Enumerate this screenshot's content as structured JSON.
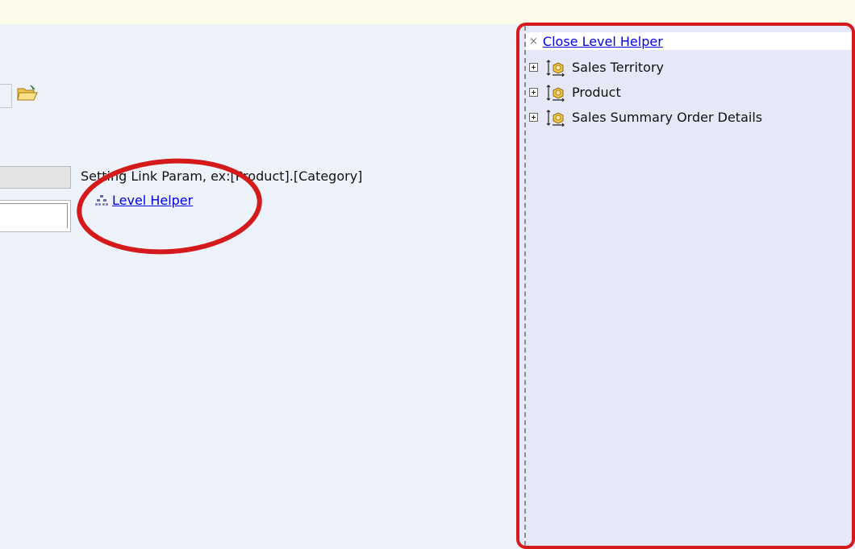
{
  "hint": {
    "text": "Setting Link Param, ex:[Product].[Category]"
  },
  "level_helper_link": {
    "label": "Level Helper"
  },
  "panel": {
    "close_label": "Close Level Helper",
    "close_glyph": "×",
    "items": [
      {
        "label": "Sales Territory",
        "icon": "cube-icon"
      },
      {
        "label": "Product",
        "icon": "cube-icon"
      },
      {
        "label": "Sales Summary Order Details",
        "icon": "cube-icon"
      }
    ]
  },
  "colors": {
    "annotation_red": "#d41a1a",
    "link_blue": "#0000ee",
    "panel_bg": "#e6e8f8",
    "page_bg": "#eef2fb",
    "top_bar": "#fdfbe9"
  }
}
